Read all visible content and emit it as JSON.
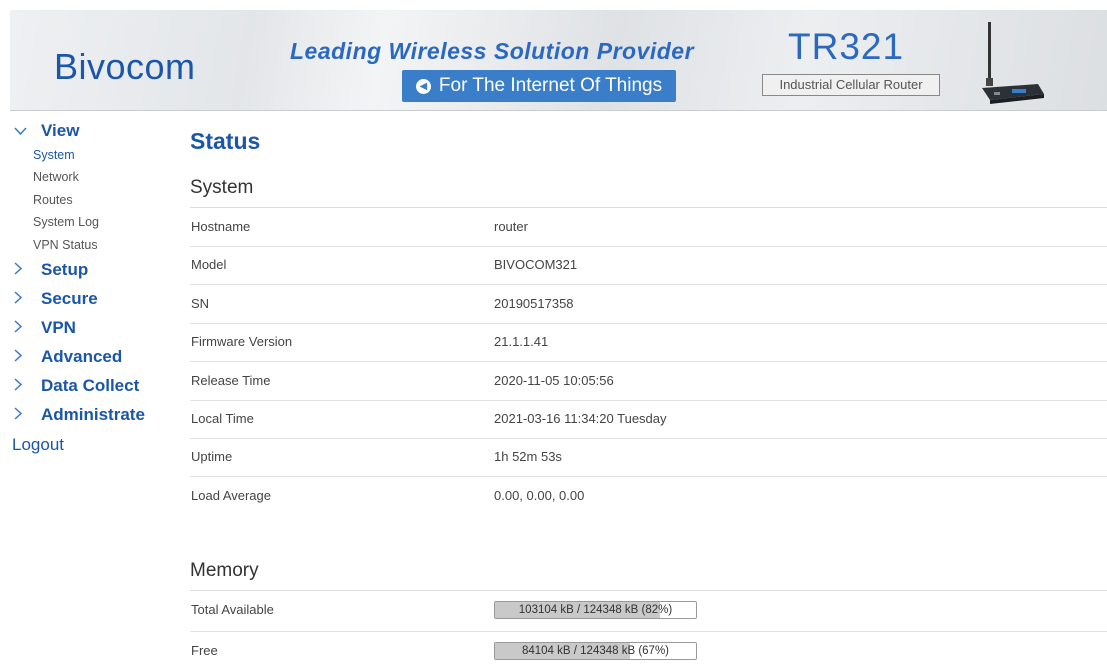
{
  "header": {
    "logo": "Bivocom",
    "tagline": "Leading Wireless Solution Provider",
    "iot_button": "For The Internet Of Things",
    "model": "TR321",
    "model_desc": "Industrial Cellular Router"
  },
  "sidebar": {
    "view": {
      "label": "View",
      "expanded": true
    },
    "view_items": [
      "System",
      "Network",
      "Routes",
      "System Log",
      "VPN Status"
    ],
    "active_item": "System",
    "groups": [
      "Setup",
      "Secure",
      "VPN",
      "Advanced",
      "Data Collect",
      "Administrate"
    ],
    "logout": "Logout"
  },
  "main": {
    "title": "Status",
    "system": {
      "title": "System",
      "rows": [
        {
          "key": "Hostname",
          "value": "router"
        },
        {
          "key": "Model",
          "value": "BIVOCOM321"
        },
        {
          "key": "SN",
          "value": "20190517358"
        },
        {
          "key": "Firmware Version",
          "value": "21.1.1.41"
        },
        {
          "key": "Release Time",
          "value": "2020-11-05 10:05:56"
        },
        {
          "key": "Local Time",
          "value": "2021-03-16 11:34:20 Tuesday"
        },
        {
          "key": "Uptime",
          "value": "1h 52m 53s"
        },
        {
          "key": "Load Average",
          "value": "0.00, 0.00, 0.00"
        }
      ]
    },
    "memory": {
      "title": "Memory",
      "rows": [
        {
          "key": "Total Available",
          "text": "103104 kB / 124348 kB (82%)",
          "percent": 82
        },
        {
          "key": "Free",
          "text": "84104 kB / 124348 kB (67%)",
          "percent": 67
        }
      ]
    }
  },
  "colors": {
    "brand_blue": "#1b57a8",
    "banner_button": "#3a7dc9",
    "bar_fill": "#c9c9c9"
  }
}
